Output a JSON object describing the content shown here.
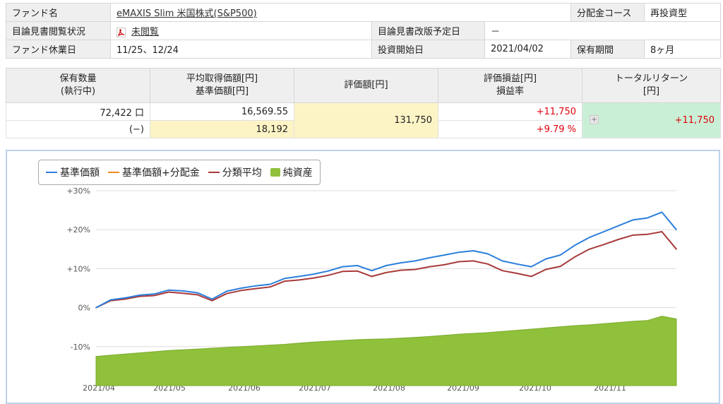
{
  "fund_info": {
    "fund_name_label": "ファンド名",
    "fund_name": "eMAXIS Slim 米国株式(S&P500)",
    "dist_course_label": "分配金コース",
    "dist_course": "再投資型",
    "prospectus_label": "目論見書閲覧状況",
    "prospectus_status": "未閲覧",
    "revision_label": "目論見書改版予定日",
    "revision_date": "－",
    "holidays_label": "ファンド休業日",
    "holidays": "11/25、12/24",
    "start_label": "投資開始日",
    "start_date": "2021/04/02",
    "period_label": "保有期間",
    "period": "8ヶ月"
  },
  "holding": {
    "headers": {
      "qty": "保有数量\n(執行中)",
      "avg": "平均取得価額[円]\n基準価額[円]",
      "value": "評価額[円]",
      "gain": "評価損益[円]\n損益率",
      "total": "トータルリターン\n[円]"
    },
    "qty": "72,422 口",
    "pending": "(−)",
    "avg_cost": "16,569.55",
    "nav": "18,192",
    "value": "131,750",
    "gain": "+11,750",
    "gain_rate": "+9.79 %",
    "total_return": "+11,750"
  },
  "legend": [
    {
      "label": "基準価額",
      "color": "#2b7fdb",
      "kind": "line"
    },
    {
      "label": "基準価額+分配金",
      "color": "#f08a24",
      "kind": "line"
    },
    {
      "label": "分類平均",
      "color": "#a93a3a",
      "kind": "line"
    },
    {
      "label": "純資産",
      "color": "#8fc13b",
      "kind": "box"
    }
  ],
  "chart_data": {
    "type": "line",
    "y_ticks": [
      "+30%",
      "+20%",
      "+10%",
      "0%",
      "-10%"
    ],
    "x_ticks": [
      "2021/04",
      "2021/05",
      "2021/06",
      "2021/07",
      "2021/08",
      "2021/09",
      "2021/10",
      "2021/11"
    ],
    "ylim": [
      -20,
      30
    ],
    "grid": true,
    "x": [
      0,
      1,
      2,
      3,
      4,
      5,
      6,
      7,
      8,
      9,
      10,
      11,
      12,
      13,
      14,
      15,
      16,
      17,
      18,
      19,
      20,
      21,
      22,
      23,
      24,
      25,
      26,
      27,
      28,
      29,
      30,
      31,
      32,
      33,
      34,
      35,
      36,
      37,
      38,
      39,
      40
    ],
    "series": [
      {
        "name": "基準価額",
        "color": "#2b7fdb",
        "values": [
          0,
          2,
          2.5,
          3.2,
          3.5,
          4.5,
          4.3,
          3.8,
          2.2,
          4.2,
          5.0,
          5.6,
          6.0,
          7.5,
          8.0,
          8.6,
          9.4,
          10.5,
          10.8,
          9.5,
          10.8,
          11.5,
          12.0,
          12.8,
          13.5,
          14.2,
          14.6,
          13.8,
          12.0,
          11.2,
          10.5,
          12.5,
          13.5,
          16.0,
          18.0,
          19.5,
          21.0,
          22.5,
          23.0,
          24.5,
          20.0
        ]
      },
      {
        "name": "分類平均",
        "color": "#a93a3a",
        "values": [
          0,
          1.8,
          2.2,
          2.9,
          3.1,
          4.0,
          3.7,
          3.3,
          1.8,
          3.6,
          4.4,
          4.9,
          5.3,
          6.8,
          7.1,
          7.6,
          8.3,
          9.3,
          9.4,
          8.0,
          9.0,
          9.6,
          9.8,
          10.5,
          11.0,
          11.8,
          12.0,
          11.2,
          9.5,
          8.8,
          8.0,
          9.8,
          10.6,
          13.0,
          15.0,
          16.2,
          17.5,
          18.6,
          18.8,
          19.5,
          15.0
        ]
      },
      {
        "name": "純資産",
        "color": "#8fc13b",
        "values": [
          -12.5,
          -12.2,
          -11.9,
          -11.6,
          -11.3,
          -11.0,
          -10.8,
          -10.6,
          -10.4,
          -10.2,
          -10.0,
          -9.8,
          -9.6,
          -9.4,
          -9.1,
          -8.8,
          -8.6,
          -8.4,
          -8.2,
          -8.1,
          -8.0,
          -7.8,
          -7.6,
          -7.4,
          -7.1,
          -6.8,
          -6.6,
          -6.4,
          -6.1,
          -5.8,
          -5.5,
          -5.2,
          -4.9,
          -4.6,
          -4.4,
          -4.1,
          -3.8,
          -3.5,
          -3.3,
          -2.2,
          -2.9
        ]
      }
    ]
  }
}
